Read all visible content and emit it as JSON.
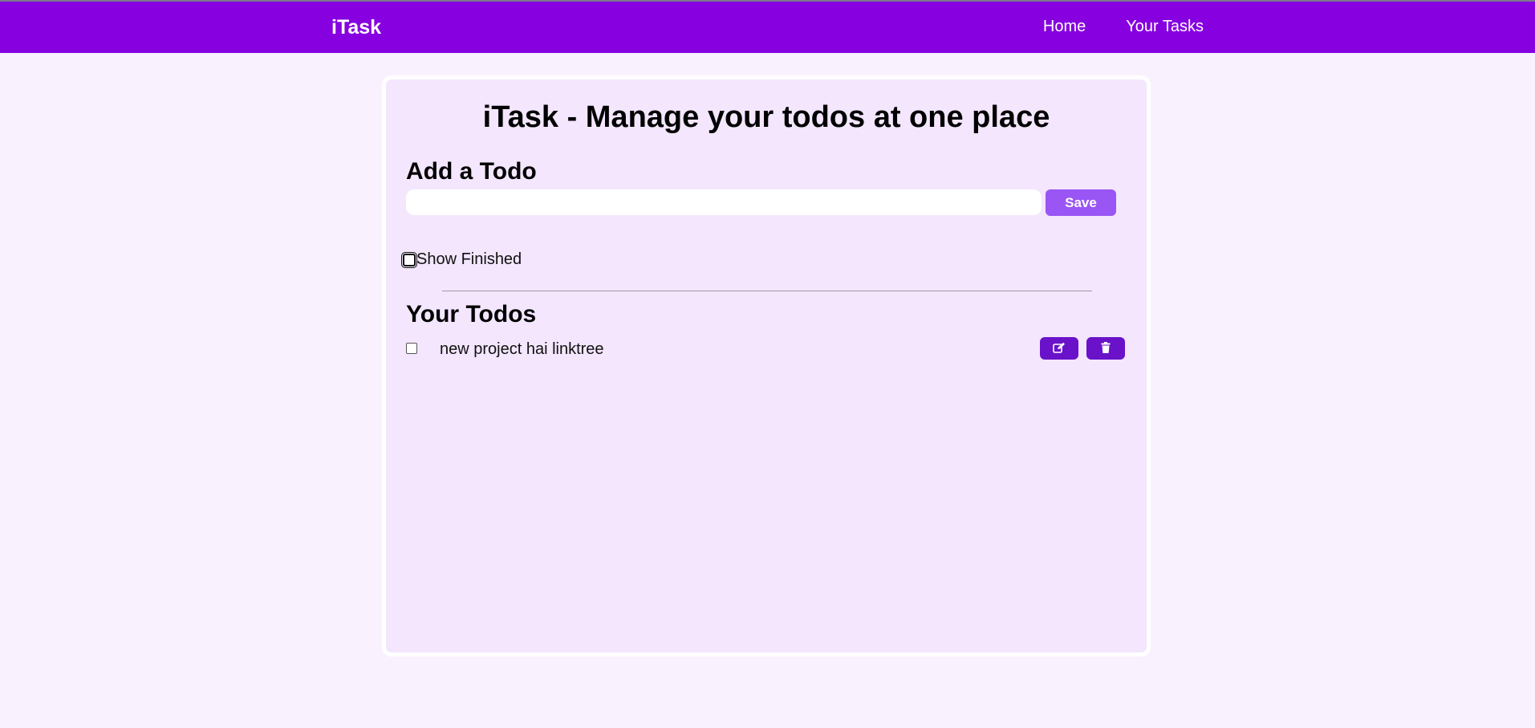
{
  "navbar": {
    "brand": "iTask",
    "links": [
      "Home",
      "Your Tasks"
    ]
  },
  "main": {
    "title": "iTask - Manage your todos at one place",
    "add_heading": "Add a Todo",
    "input_value": "",
    "save_label": "Save",
    "show_finished_label": "Show Finished",
    "show_finished_checked": false,
    "todos_heading": "Your Todos",
    "todos": [
      {
        "text": "new project hai linktree",
        "done": false,
        "actions": [
          "edit-icon",
          "trash-icon"
        ]
      }
    ]
  },
  "colors": {
    "navbar": "#8600e0",
    "page_background": "#f9f2fe",
    "card_background": "#f3e6fd",
    "save_button": "#9a55f5",
    "action_button": "#6a12c9"
  }
}
